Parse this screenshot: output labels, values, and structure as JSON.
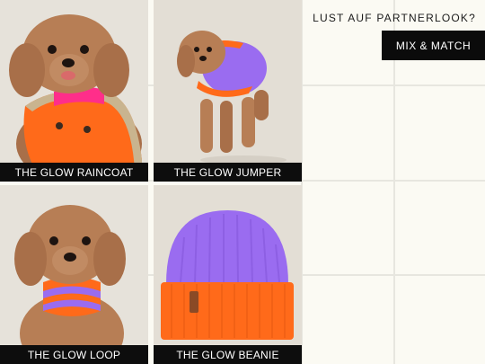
{
  "products": [
    {
      "title": "THE GLOW RAINCOAT",
      "image": "dog-wearing-orange-raincoat"
    },
    {
      "title": "THE GLOW JUMPER",
      "image": "dog-wearing-purple-jumper"
    },
    {
      "title": "THE GLOW LOOP",
      "image": "dog-wearing-striped-loop"
    },
    {
      "title": "THE GLOW BEANIE",
      "image": "purple-orange-beanie"
    }
  ],
  "promo": {
    "title": "LUST AUF PARTNERLOOK?",
    "button_label": "MIX & MATCH"
  },
  "colors": {
    "background": "#fbfaf3",
    "caption_bar": "#0d0d0d",
    "neon_orange": "#ff6a1a",
    "purple": "#9a6cf0",
    "hot_pink": "#ff2e8a",
    "dog_fur": "#b77e55"
  }
}
